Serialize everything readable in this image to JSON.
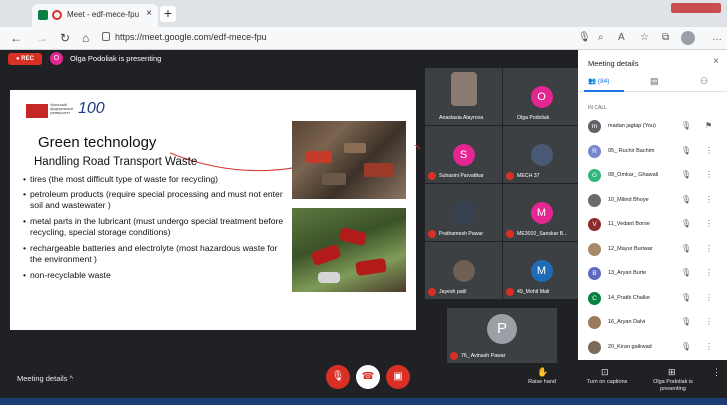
{
  "browser": {
    "tab_title": "Meet - edf-mece-fpu",
    "tab_close": "×",
    "new_tab": "+",
    "url": "https://meet.google.com/edf-mece-fpu"
  },
  "meet": {
    "rec_label": "● REC",
    "presenter_initial": "O",
    "presenter_text": "Olga Podoliak is presenting"
  },
  "slide": {
    "logo_small": "Уральский федеральный университет",
    "logo_100": "100",
    "title": "Green technology",
    "subtitle": "Handling Road Transport Waste",
    "bullets": [
      "tires (the most difficult type of waste for recycling)",
      "petroleum products (require special processing and must not enter soil and wastewater )",
      "metal parts in the lubricant (must undergo special treatment before recycling, special storage conditions)",
      "rechargeable batteries and electrolyte (most hazardous waste for the environment )",
      "non-recyclable waste"
    ]
  },
  "tiles": [
    {
      "name": "Anastasia Alayrova",
      "initial": "",
      "color": "#5d6b7a"
    },
    {
      "name": "Olga Podoliak",
      "initial": "O",
      "color": "#e52592"
    },
    {
      "name": "Suhasini Parvatikar",
      "initial": "S",
      "color": "#e52592"
    },
    {
      "name": "MECH 37",
      "initial": "",
      "color": "#4b5a74"
    },
    {
      "name": "Prathamesh Pawar",
      "initial": "",
      "color": "#38414f"
    },
    {
      "name": "ME3010_Sanskar B...",
      "initial": "M",
      "color": "#e52592"
    },
    {
      "name": "Jayesh patil",
      "initial": "",
      "color": "#6f5e52"
    },
    {
      "name": "49_Mohit Mali",
      "initial": "M",
      "color": "#1e6bb8"
    }
  ],
  "self_tile": {
    "name": "76_ Avinash Pawar",
    "initial": "P"
  },
  "bottom": {
    "meeting_details": "Meeting details ^",
    "raise_hand": "Raise hand",
    "captions": "Turn on captions",
    "presenting": "Olga Podoliak is presenting",
    "mic_icon": "🎙",
    "end_icon": "☎",
    "cam_icon": "▣"
  },
  "panel": {
    "title": "Meeting details",
    "close": "×",
    "tab_people": "👥 (84)",
    "tab_chat": "▤",
    "tab_activities": "⚇",
    "in_call": "IN CALL",
    "participants": [
      {
        "initial": "m",
        "name": "madan jagtap (You)",
        "color": "#5f6368"
      },
      {
        "initial": "R",
        "name": "05_ Ruchir Bachim",
        "color": "#7986cb"
      },
      {
        "initial": "G",
        "name": "08_Omkar_ Ghawali",
        "color": "#33b679"
      },
      {
        "initial": "",
        "name": "10_Milind Bhoye",
        "color": "#6b6b6b"
      },
      {
        "initial": "V",
        "name": "11_Vedant Borse",
        "color": "#8d2a2a"
      },
      {
        "initial": "",
        "name": "12_Mayur Buriwar",
        "color": "#a88a6a"
      },
      {
        "initial": "B",
        "name": "13_Aryan Burte",
        "color": "#5c6bc0"
      },
      {
        "initial": "C",
        "name": "14_Pratik Chalke",
        "color": "#0b8043"
      },
      {
        "initial": "",
        "name": "16_Aryan Dalvi",
        "color": "#9b7b5b"
      },
      {
        "initial": "",
        "name": "20_Kiran gaikwad",
        "color": "#7a6a5a"
      }
    ]
  }
}
